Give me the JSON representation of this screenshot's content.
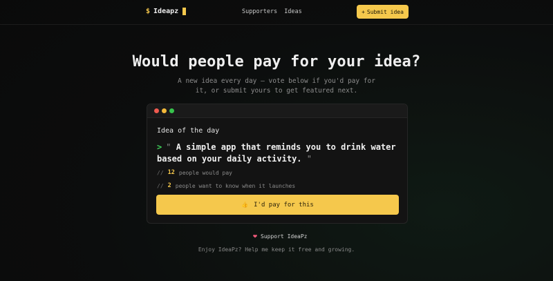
{
  "header": {
    "logo_symbol": "$",
    "logo_text": "Ideapz",
    "nav": [
      "Supporters",
      "Ideas"
    ],
    "submit_label": "Submit idea",
    "submit_prefix": "+"
  },
  "hero": {
    "title": "Would people pay for your idea?",
    "subtitle": "A new idea every day — vote below if you'd pay for it, or submit yours to get featured next."
  },
  "card": {
    "label": "Idea of the day",
    "prompt_symbol": ">",
    "quote_open": "\"",
    "quote_close": "\"",
    "idea_text": "A simple app that reminds you to drink water based on your daily activity.",
    "stats": [
      {
        "prefix": "//",
        "count": "12",
        "text": "people would pay"
      },
      {
        "prefix": "//",
        "count": "2",
        "text": "people want to know when it launches"
      }
    ],
    "pay_button_label": "I'd pay for this",
    "pay_button_icon": "👍"
  },
  "support": {
    "icon": "❤",
    "label": "Support IdeaPz",
    "text": "Enjoy IdeaPz? Help me keep it free and growing."
  },
  "colors": {
    "accent": "#f5c84c",
    "background": "#0c0d0d",
    "prompt_green": "#3fd15a",
    "heart": "#f05a7a"
  }
}
